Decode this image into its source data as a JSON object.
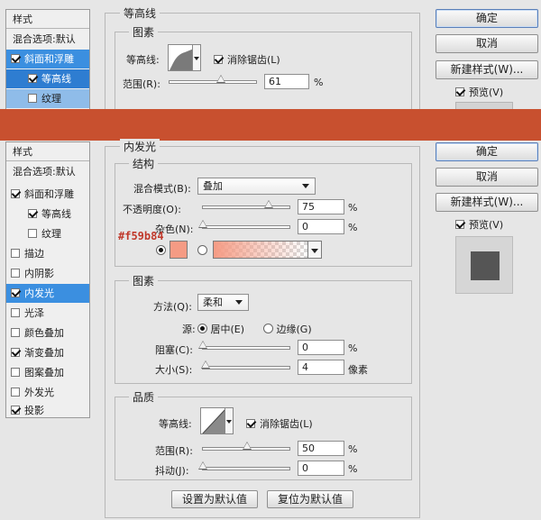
{
  "top": {
    "sidebar": {
      "header": "样式",
      "items": [
        {
          "label": "混合选项:默认"
        },
        {
          "label": "斜面和浮雕",
          "checked": true
        },
        {
          "label": "等高线",
          "checked": true
        },
        {
          "label": "纹理",
          "checked": false
        }
      ]
    },
    "section_title": "等高线",
    "group_title": "图素",
    "contour_label": "等高线:",
    "antialias_label": "消除锯齿(L)",
    "range_label": "范围(R):",
    "range_value": "61",
    "range_unit": "%",
    "buttons": {
      "ok": "确定",
      "cancel": "取消",
      "new_style": "新建样式(W)...",
      "preview": "预览(V)"
    }
  },
  "main": {
    "sidebar": {
      "header": "样式",
      "items": [
        {
          "label": "混合选项:默认"
        },
        {
          "label": "斜面和浮雕",
          "checked": true
        },
        {
          "label": "等高线",
          "checked": true
        },
        {
          "label": "纹理",
          "checked": false
        },
        {
          "label": "描边",
          "checked": false
        },
        {
          "label": "内阴影",
          "checked": false
        },
        {
          "label": "内发光",
          "checked": true
        },
        {
          "label": "光泽",
          "checked": false
        },
        {
          "label": "颜色叠加",
          "checked": false
        },
        {
          "label": "渐变叠加",
          "checked": true
        },
        {
          "label": "图案叠加",
          "checked": false
        },
        {
          "label": "外发光",
          "checked": false
        },
        {
          "label": "投影",
          "checked": true
        }
      ]
    },
    "section_title": "内发光",
    "structure": {
      "title": "结构",
      "blend_mode_label": "混合模式(B):",
      "blend_mode_value": "叠加",
      "opacity_label": "不透明度(O):",
      "opacity_value": "75",
      "noise_label": "杂色(N):",
      "noise_value": "0",
      "unit": "%",
      "color_annotation": "#f59b84",
      "glow_color": "#f59b84"
    },
    "elements": {
      "title": "图素",
      "method_label": "方法(Q):",
      "method_value": "柔和",
      "source_label": "源:",
      "source_center": "居中(E)",
      "source_edge": "边缘(G)",
      "choke_label": "阻塞(C):",
      "choke_value": "0",
      "choke_unit": "%",
      "size_label": "大小(S):",
      "size_value": "4",
      "size_unit": "像素"
    },
    "quality": {
      "title": "品质",
      "contour_label": "等高线:",
      "antialias_label": "消除锯齿(L)",
      "range_label": "范围(R):",
      "range_value": "50",
      "jitter_label": "抖动(J):",
      "jitter_value": "0",
      "unit": "%"
    },
    "footer": {
      "make_default": "设置为默认值",
      "reset_default": "复位为默认值"
    },
    "buttons": {
      "ok": "确定",
      "cancel": "取消",
      "new_style": "新建样式(W)...",
      "preview": "预览(V)"
    }
  },
  "colors": {
    "divider": "#c8502f",
    "selection": "#3b8fe0",
    "annotation": "#c0392b"
  }
}
